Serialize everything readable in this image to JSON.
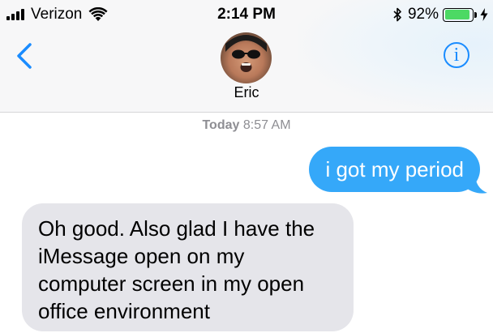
{
  "status_bar": {
    "carrier": "Verizon",
    "time": "2:14 PM",
    "battery_percent": "92%",
    "battery_level": 0.92,
    "icons": [
      "signal-icon",
      "wifi-icon",
      "bluetooth-icon",
      "battery-icon",
      "charging-bolt-icon"
    ]
  },
  "header": {
    "back_icon": "chevron-left-icon",
    "contact_name": "Eric",
    "info_icon": "info-icon",
    "info_glyph": "i"
  },
  "conversation": {
    "timestamp_day": "Today",
    "timestamp_time": "8:57 AM",
    "messages": [
      {
        "direction": "outgoing",
        "text": "i got my period"
      },
      {
        "direction": "incoming",
        "text": "Oh good. Also glad I have the iMessage open on my computer screen in my open office environment"
      }
    ]
  },
  "colors": {
    "accent": "#1a8cff",
    "outgoing_bubble": "#35a8f9",
    "incoming_bubble": "#e5e5ea",
    "battery": "#4cd964",
    "timestamp": "#8e8e93"
  }
}
